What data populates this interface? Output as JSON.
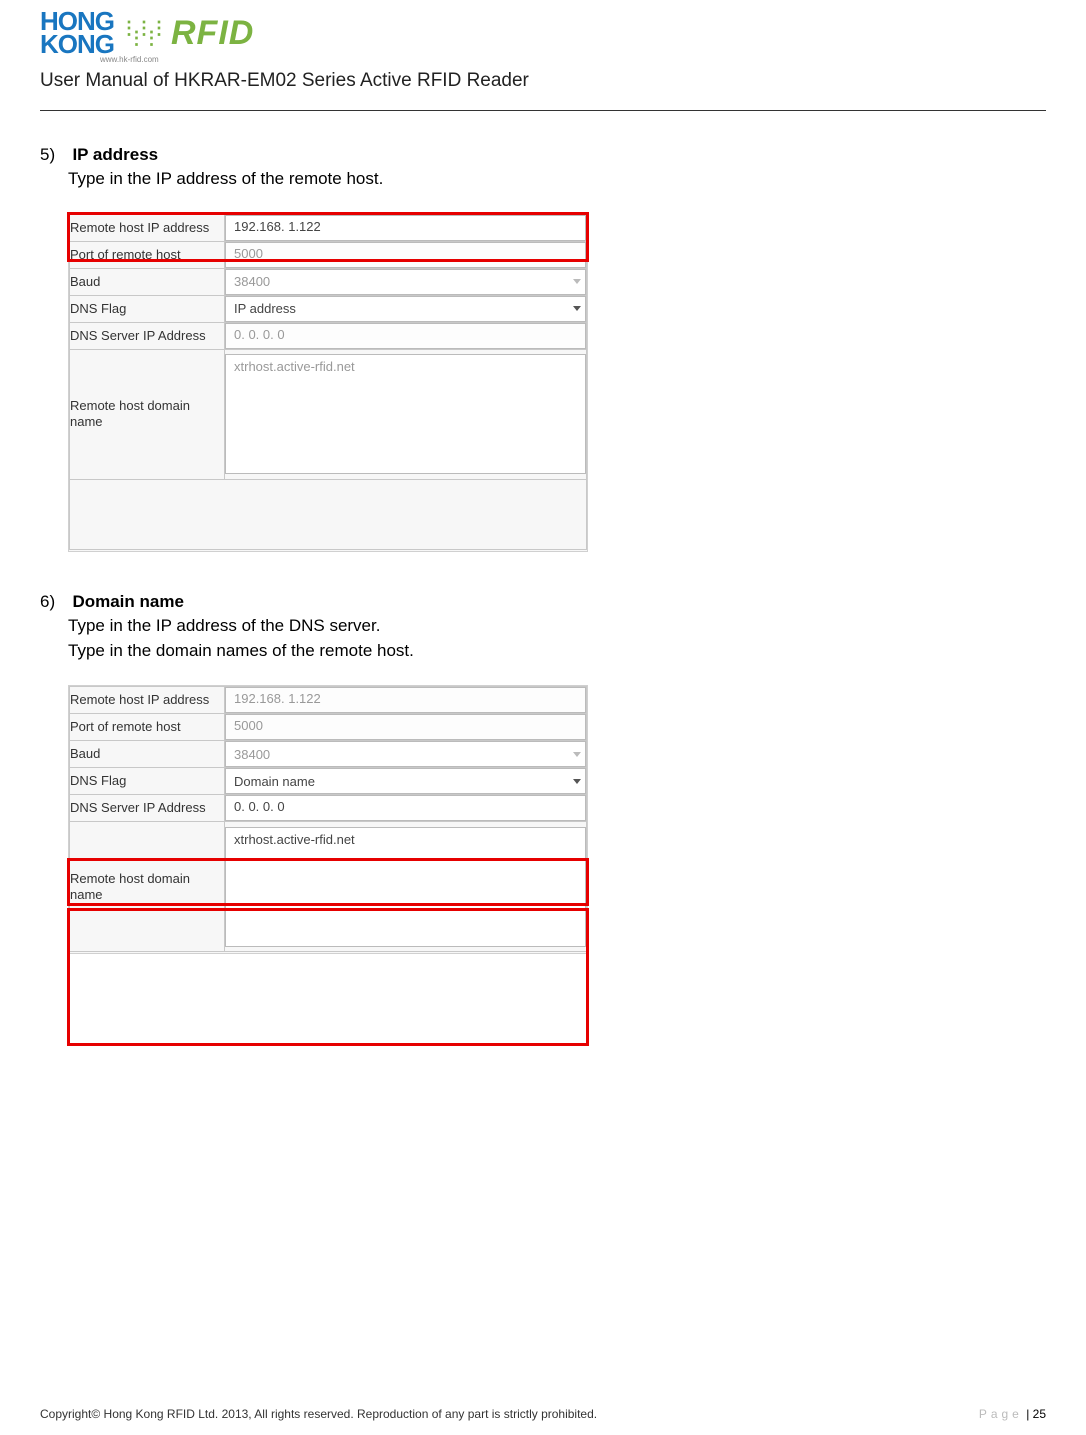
{
  "header": {
    "logo_hk_top": "HONG",
    "logo_hk_bottom": "KONG",
    "logo_rfid": "RFID",
    "logo_url": "www.hk-rfid.com",
    "manual_title": "User Manual of HKRAR-EM02 Series Active RFID Reader"
  },
  "section5": {
    "number": "5)",
    "title": "IP address",
    "body": "Type in the IP address of the remote host.",
    "form": {
      "remote_ip_label": "Remote host IP address",
      "remote_ip_value": "192.168.  1.122",
      "port_label": "Port of remote host",
      "port_value": "5000",
      "baud_label": "Baud",
      "baud_value": "38400",
      "dnsflag_label": "DNS Flag",
      "dnsflag_value": "IP address",
      "dnsserver_label": "DNS Server IP Address",
      "dnsserver_value": " 0.  0.  0.  0",
      "domain_label": "Remote host domain name",
      "domain_value": "xtrhost.active-rfid.net"
    }
  },
  "section6": {
    "number": "6)",
    "title": "Domain name",
    "body1": "Type in the IP address of the DNS server.",
    "body2": "Type in the domain names of the remote host.",
    "form": {
      "remote_ip_label": "Remote host IP address",
      "remote_ip_value": "192.168.  1.122",
      "port_label": "Port of remote host",
      "port_value": "5000",
      "baud_label": "Baud",
      "baud_value": "38400",
      "dnsflag_label": "DNS Flag",
      "dnsflag_value": "Domain name",
      "dnsserver_label": "DNS Server IP Address",
      "dnsserver_value": " 0.  0.  0.  0",
      "domain_label": "Remote host domain name",
      "domain_value": "xtrhost.active-rfid.net"
    }
  },
  "footer": {
    "copyright": "Copyright© Hong Kong RFID Ltd. 2013, All rights reserved. Reproduction of any part is strictly prohibited.",
    "page_label": "Page",
    "page_num": "| 25"
  }
}
